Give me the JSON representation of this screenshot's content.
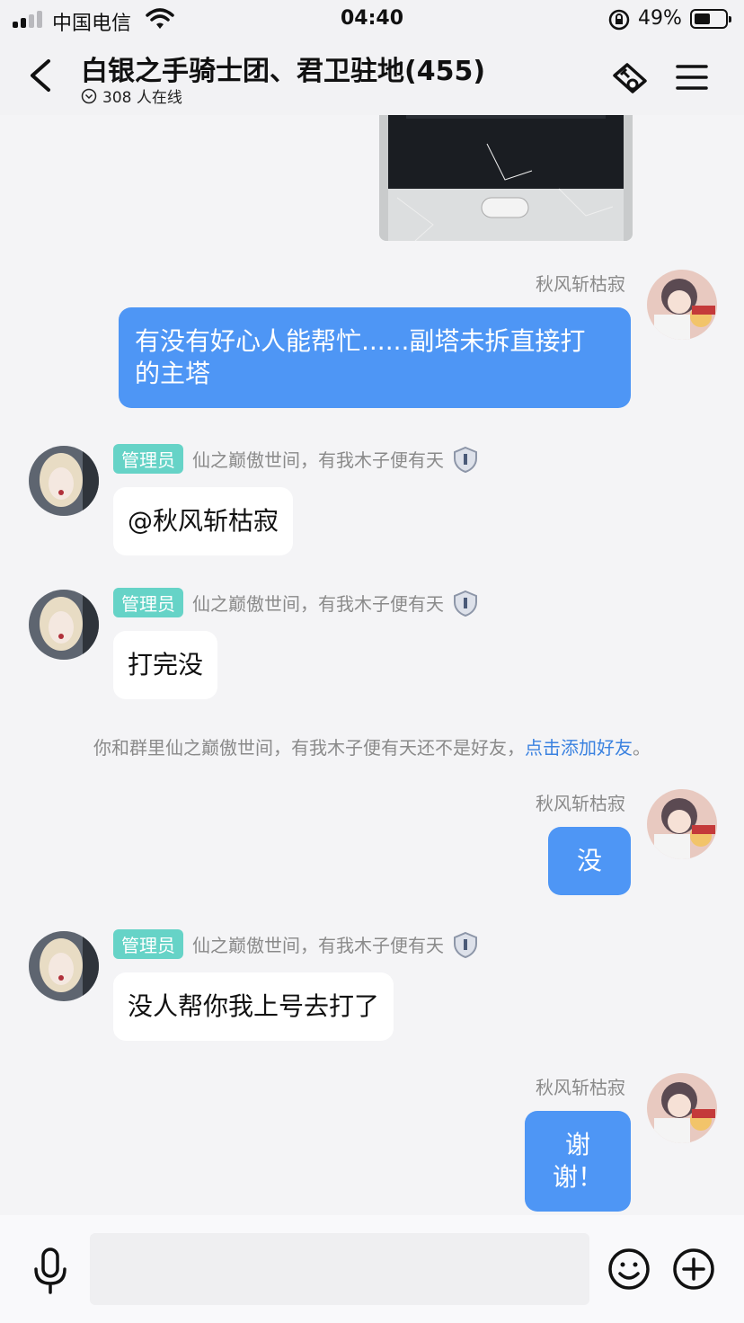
{
  "status_bar": {
    "carrier": "中国电信",
    "time": "04:40",
    "battery_percent": "49%",
    "battery_level": 0.49
  },
  "header": {
    "title": "白银之手骑士团、君卫驻地(455)",
    "online": "308 人在线",
    "icons": [
      "back-icon",
      "game-controller-icon",
      "menu-icon"
    ]
  },
  "messages": [
    {
      "type": "image",
      "side": "right",
      "description_icon": "phone-photo"
    },
    {
      "type": "text",
      "side": "right",
      "sender": "秋风斩枯寂",
      "text_line1": "有没有好心人能帮忙......副塔未拆直接打",
      "text_line2": "的主塔"
    },
    {
      "type": "text",
      "side": "left",
      "badge": "管理员",
      "sender": "仙之巅傲世间，有我木子便有天",
      "text": "@秋风斩枯寂"
    },
    {
      "type": "text",
      "side": "left",
      "badge": "管理员",
      "sender": "仙之巅傲世间，有我木子便有天",
      "text": "打完没"
    },
    {
      "type": "system",
      "text": "你和群里仙之巅傲世间，有我木子便有天还不是好友，",
      "link": "点击添加好友",
      "suffix": "。"
    },
    {
      "type": "text",
      "side": "right",
      "sender": "秋风斩枯寂",
      "text": "没"
    },
    {
      "type": "text",
      "side": "left",
      "badge": "管理员",
      "sender": "仙之巅傲世间，有我木子便有天",
      "text": "没人帮你我上号去打了"
    },
    {
      "type": "text",
      "side": "right",
      "sender": "秋风斩枯寂",
      "text": "谢谢！"
    }
  ],
  "input_bar": {
    "placeholder": "",
    "icons": [
      "microphone-icon",
      "emoji-icon",
      "plus-icon"
    ]
  },
  "colors": {
    "outgoing_bubble": "#4e96f5",
    "admin_badge": "#66d3c7",
    "link": "#3b82e0"
  }
}
